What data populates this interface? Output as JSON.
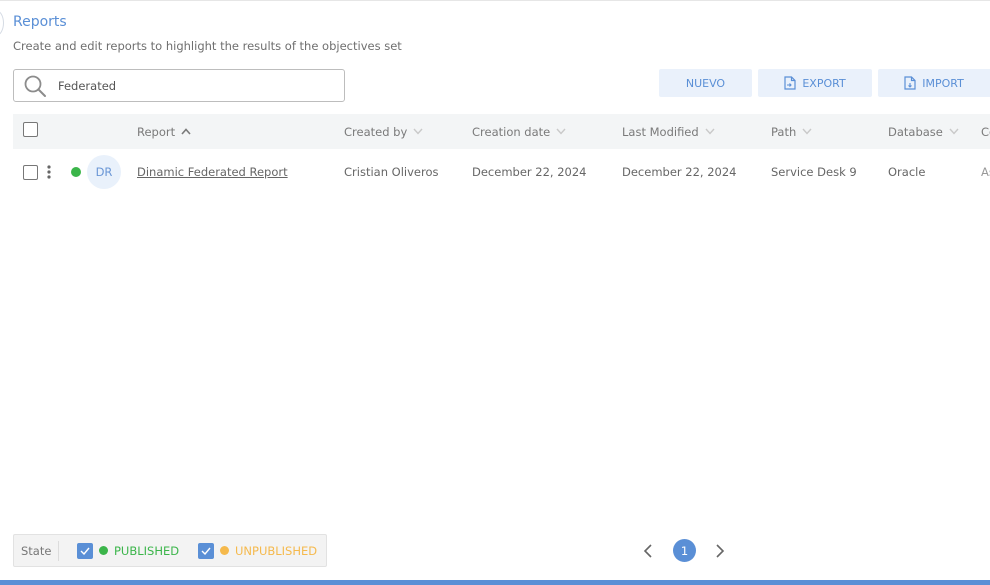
{
  "header": {
    "title": "Reports",
    "subtitle": "Create and edit reports to highlight the results of the objectives set"
  },
  "search": {
    "value": "Federated",
    "icon": "search-icon"
  },
  "actions": {
    "nuevo_label": "NUEVO",
    "export_label": "EXPORT",
    "import_label": "IMPORT"
  },
  "table": {
    "columns": [
      "Report",
      "Created by",
      "Creation date",
      "Last Modified",
      "Path",
      "Database",
      "Co"
    ],
    "rows": [
      {
        "status": "published",
        "avatar": "DR",
        "report": "Dinamic Federated Report",
        "created_by": "Cristian Oliveros",
        "creation_date": "December 22, 2024",
        "last_modified": "December 22, 2024",
        "path": "Service Desk 9",
        "database": "Oracle",
        "extra": "As"
      }
    ]
  },
  "state_filter": {
    "label": "State",
    "published": "PUBLISHED",
    "unpublished": "UNPUBLISHED"
  },
  "pagination": {
    "current_page": "1"
  },
  "colors": {
    "accent": "#5a8fd6",
    "published": "#3bb54a",
    "unpublished": "#f5b94c"
  }
}
